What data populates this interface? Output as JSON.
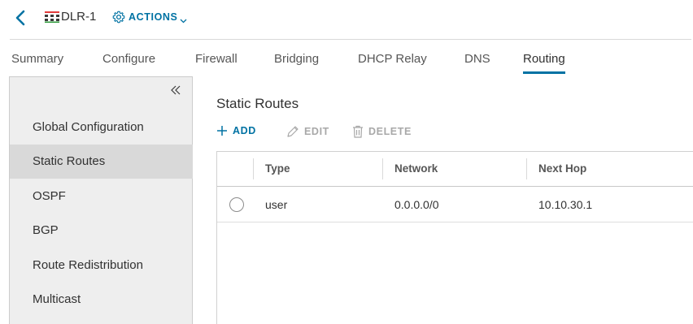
{
  "header": {
    "object_name": "DLR-1",
    "actions_label": "ACTIONS"
  },
  "tabs": [
    {
      "label": "Summary"
    },
    {
      "label": "Configure"
    },
    {
      "label": "Firewall"
    },
    {
      "label": "Bridging"
    },
    {
      "label": "DHCP Relay"
    },
    {
      "label": "DNS"
    },
    {
      "label": "Routing",
      "active": true
    }
  ],
  "sidebar": {
    "items": [
      {
        "label": "Global Configuration"
      },
      {
        "label": "Static Routes",
        "active": true
      },
      {
        "label": "OSPF"
      },
      {
        "label": "BGP"
      },
      {
        "label": "Route Redistribution"
      },
      {
        "label": "Multicast"
      }
    ]
  },
  "main": {
    "title": "Static Routes",
    "toolbar": {
      "add": "ADD",
      "edit": "EDIT",
      "delete": "DELETE"
    },
    "table": {
      "columns": [
        "Type",
        "Network",
        "Next Hop"
      ],
      "rows": [
        {
          "type": "user",
          "network": "0.0.0.0/0",
          "next_hop": "10.10.30.1"
        }
      ]
    }
  },
  "colors": {
    "accent": "#0072a3",
    "sidebar_bg": "#eeeeee",
    "sidebar_active": "#d9d9d9",
    "disabled": "#a8a8a8"
  }
}
